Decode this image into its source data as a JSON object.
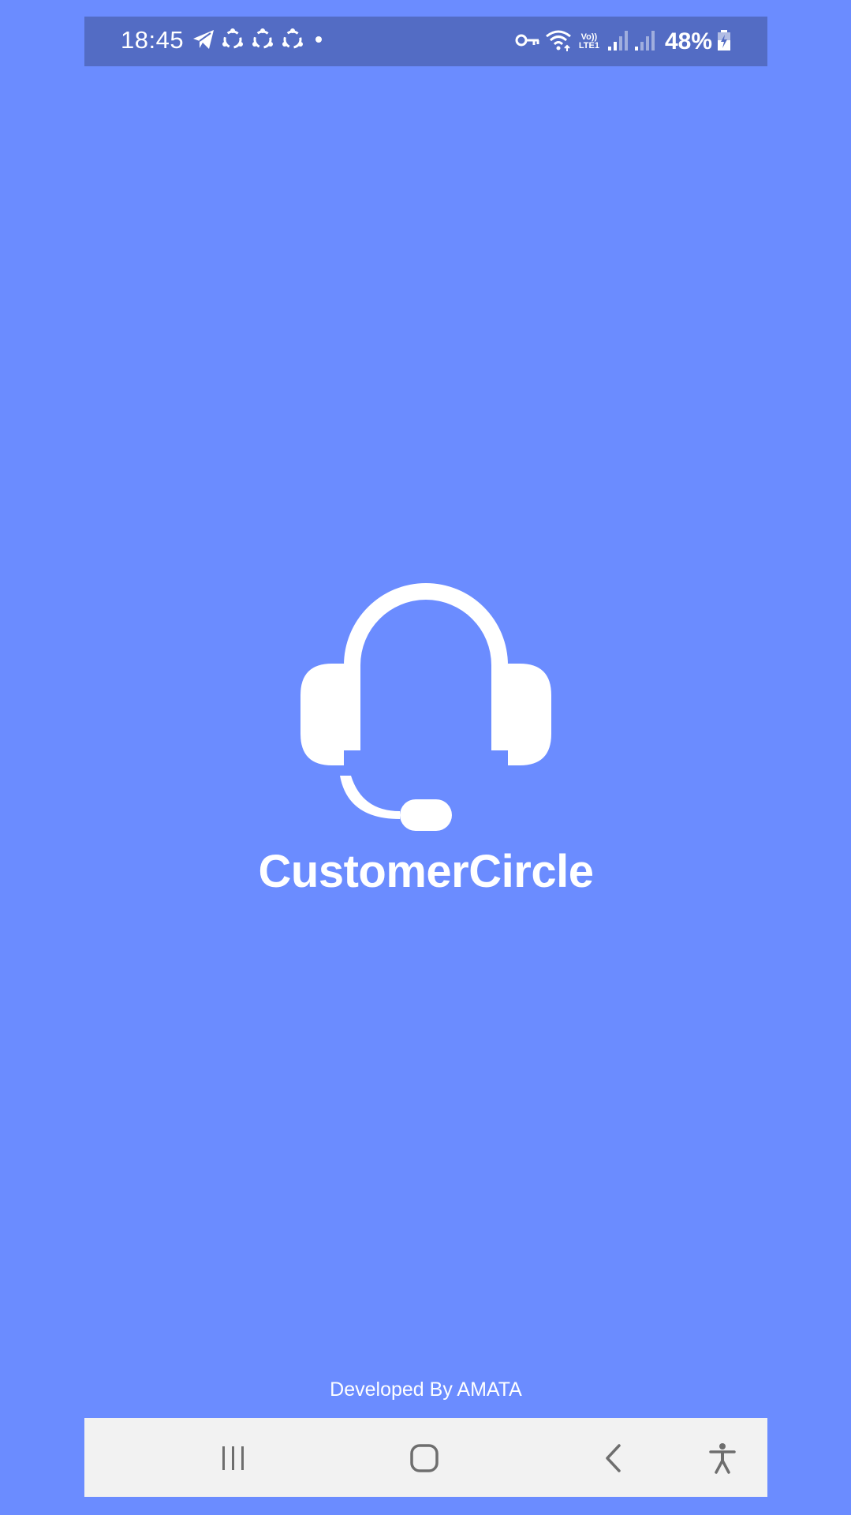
{
  "status_bar": {
    "time": "18:45",
    "battery": "48%",
    "network_label_top": "Vo))",
    "network_label_bottom": "LTE1"
  },
  "splash": {
    "app_name": "CustomerCircle",
    "developer": "Developed By AMATA",
    "logo_icon": "headset-icon"
  },
  "colors": {
    "background": "#6b8cff",
    "status_bar": "#536cc4",
    "nav_bar": "#f2f2f2",
    "nav_icon": "#6e6e6e"
  },
  "nav_bar": {
    "icons": [
      "recent-apps-icon",
      "home-icon",
      "back-icon",
      "accessibility-icon"
    ]
  }
}
